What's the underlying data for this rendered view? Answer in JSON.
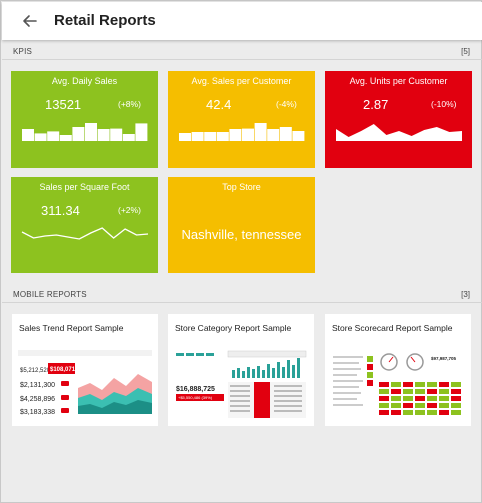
{
  "header": {
    "title": "Retail Reports"
  },
  "kpis_section": {
    "label": "KPIS",
    "count": "[5]"
  },
  "kpis": [
    {
      "title": "Avg. Daily Sales",
      "value": "13521",
      "delta": "(+8%)",
      "color": "#8dc21f",
      "sparkline_type": "bar",
      "sparkline": [
        0.6,
        0.38,
        0.48,
        0.3,
        0.7,
        0.9,
        0.6,
        0.62,
        0.35,
        0.88
      ]
    },
    {
      "title": "Avg. Sales per Customer",
      "value": "42.4",
      "delta": "(-4%)",
      "color": "#f5be00",
      "sparkline_type": "bar",
      "sparkline": [
        0.4,
        0.45,
        0.45,
        0.45,
        0.6,
        0.62,
        0.9,
        0.6,
        0.7,
        0.5
      ]
    },
    {
      "title": "Avg. Units per Customer",
      "value": "2.87",
      "delta": "(-10%)",
      "color": "#e1000f",
      "sparkline_type": "area",
      "sparkline": [
        0.6,
        0.2,
        0.5,
        0.85,
        0.3,
        0.5,
        0.25,
        0.55,
        0.7,
        0.45,
        0.5
      ]
    },
    {
      "title": "Sales per Square Foot",
      "value": "311.34",
      "delta": "(+2%)",
      "color": "#8dc21f",
      "sparkline_type": "line",
      "sparkline": [
        0.7,
        0.4,
        0.5,
        0.55,
        0.45,
        0.35,
        0.65,
        0.9,
        0.4,
        0.85,
        0.55,
        0.6
      ]
    },
    {
      "title": "Top Store",
      "value": "Nashville, tennessee",
      "color": "#f5be00"
    }
  ],
  "reports_section": {
    "label": "MOBILE REPORTS",
    "count": "[3]"
  },
  "reports": [
    {
      "title": "Sales Trend Report Sample",
      "thumb": {
        "v1": "$5,212,520",
        "badge": "$108,071",
        "v2": "$2,131,300",
        "v3": "$4,258,896",
        "v4": "$3,183,338"
      }
    },
    {
      "title": "Store Category Report Sample",
      "thumb": {
        "v1": "$16,888,725",
        "badge": "+$5,550,486 (39%)"
      }
    },
    {
      "title": "Store Scorecard Report Sample",
      "thumb": {
        "v1": "$97,987,705"
      }
    }
  ]
}
